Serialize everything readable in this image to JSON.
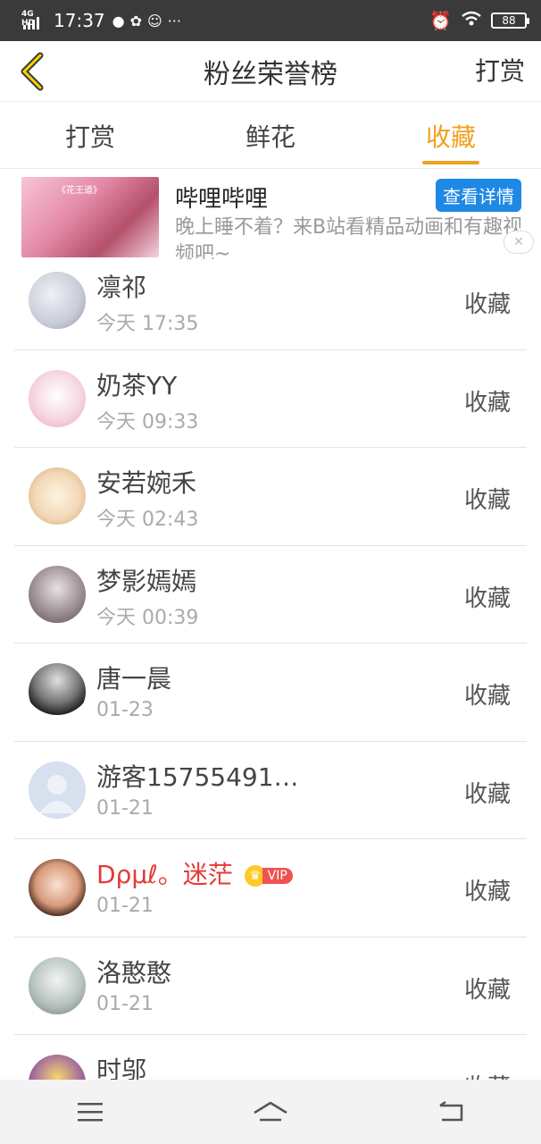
{
  "status_bar": {
    "network": "4G HD",
    "time": "17:37",
    "notification_icons": [
      "chat-bubble-icon",
      "pinwheel-icon",
      "cat-icon"
    ],
    "overflow": "···",
    "battery": "88"
  },
  "header": {
    "title": "粉丝荣誉榜",
    "action_label": "打赏"
  },
  "tabs": [
    {
      "label": "打赏",
      "active": false
    },
    {
      "label": "鲜花",
      "active": false
    },
    {
      "label": "收藏",
      "active": true
    }
  ],
  "ad": {
    "title": "哔哩哔哩",
    "button": "查看详情",
    "description": "晚上睡不着？来B站看精品动画和有趣视频吧~",
    "image_tag": "《花王道》",
    "close": "✕"
  },
  "list": [
    {
      "name": "凛祁",
      "time": "今天 17:35",
      "action": "收藏",
      "vip": false,
      "avatar_color": "#c8ccd8"
    },
    {
      "name": "奶茶YY",
      "time": "今天 09:33",
      "action": "收藏",
      "vip": false,
      "avatar_color": "#f6d6e2"
    },
    {
      "name": "安若婉禾",
      "time": "今天 02:43",
      "action": "收藏",
      "vip": false,
      "avatar_color": "#f2d9b8"
    },
    {
      "name": "梦影嫣嫣",
      "time": "今天 00:39",
      "action": "收藏",
      "vip": false,
      "avatar_color": "#9c8f96"
    },
    {
      "name": "唐一晨",
      "time": "01-23",
      "action": "收藏",
      "vip": false,
      "avatar_color": "#5a5a5a"
    },
    {
      "name": "游客15755491…",
      "time": "01-21",
      "action": "收藏",
      "vip": false,
      "avatar_color": "#d7e0ee"
    },
    {
      "name": "Dρμℓ。迷茫",
      "time": "01-21",
      "action": "收藏",
      "vip": true,
      "vip_label": "VIP",
      "avatar_color": "#d89a7a"
    },
    {
      "name": "洛憨憨",
      "time": "01-21",
      "action": "收藏",
      "vip": false,
      "avatar_color": "#b8c4c0"
    },
    {
      "name": "时邬",
      "time": "",
      "action": "收藏",
      "vip": false,
      "avatar_color": "#a06a9c"
    }
  ],
  "nav": [
    "menu-icon",
    "home-icon",
    "back-icon"
  ]
}
